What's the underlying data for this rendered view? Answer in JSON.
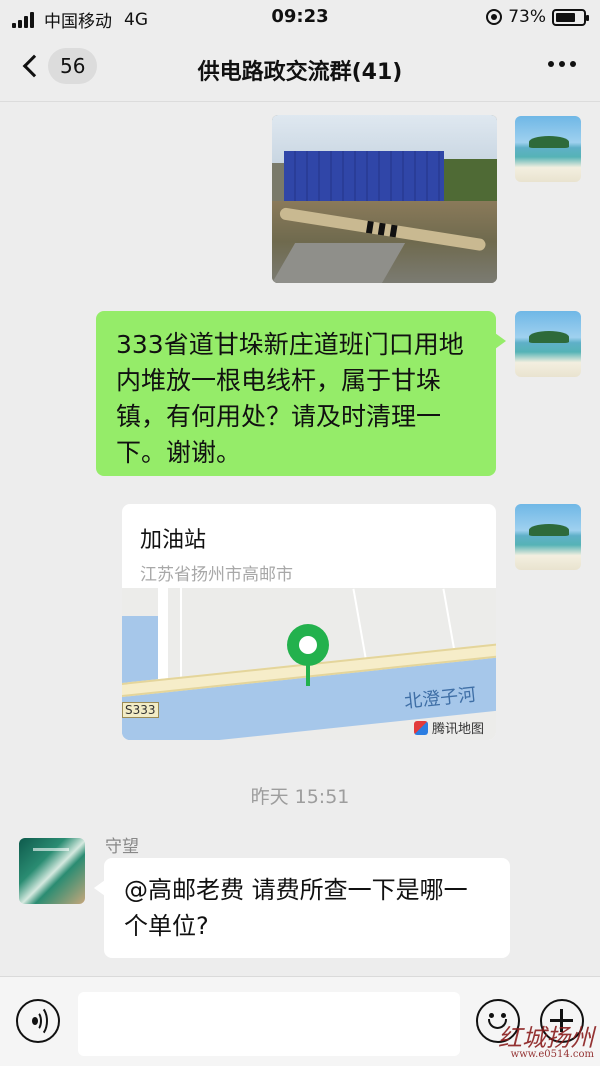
{
  "status_bar": {
    "carrier": "中国移动",
    "network": "4G",
    "time": "09:23",
    "battery_percent": "73%",
    "battery_level": 0.73
  },
  "nav": {
    "unread_count": "56",
    "title": "供电路政交流群(41)"
  },
  "messages": [
    {
      "type": "image",
      "side": "right",
      "description_icon": "photo-thumbnail"
    },
    {
      "type": "text",
      "side": "right",
      "text": "333省道甘垛新庄道班门口用地内堆放一根电线杆，属于甘垛镇，有何用处？请及时清理一下。谢谢。"
    },
    {
      "type": "location",
      "side": "right",
      "name": "加油站",
      "address": "江苏省扬州市高邮市",
      "map": {
        "road_label": "S333",
        "river_label": "北澄子河",
        "credit": "腾讯地图"
      }
    }
  ],
  "timestamp": "昨天 15:51",
  "incoming": {
    "sender": "守望",
    "text": "@高邮老费 请费所查一下是哪一个单位?"
  },
  "input_bar": {
    "placeholder": ""
  },
  "watermark": {
    "text": "红城扬州",
    "url": "www.e0514.com"
  },
  "colors": {
    "background": "#ededed",
    "outgoing_bubble": "#95ec69",
    "incoming_bubble": "#ffffff",
    "map_pin": "#23b14d"
  }
}
